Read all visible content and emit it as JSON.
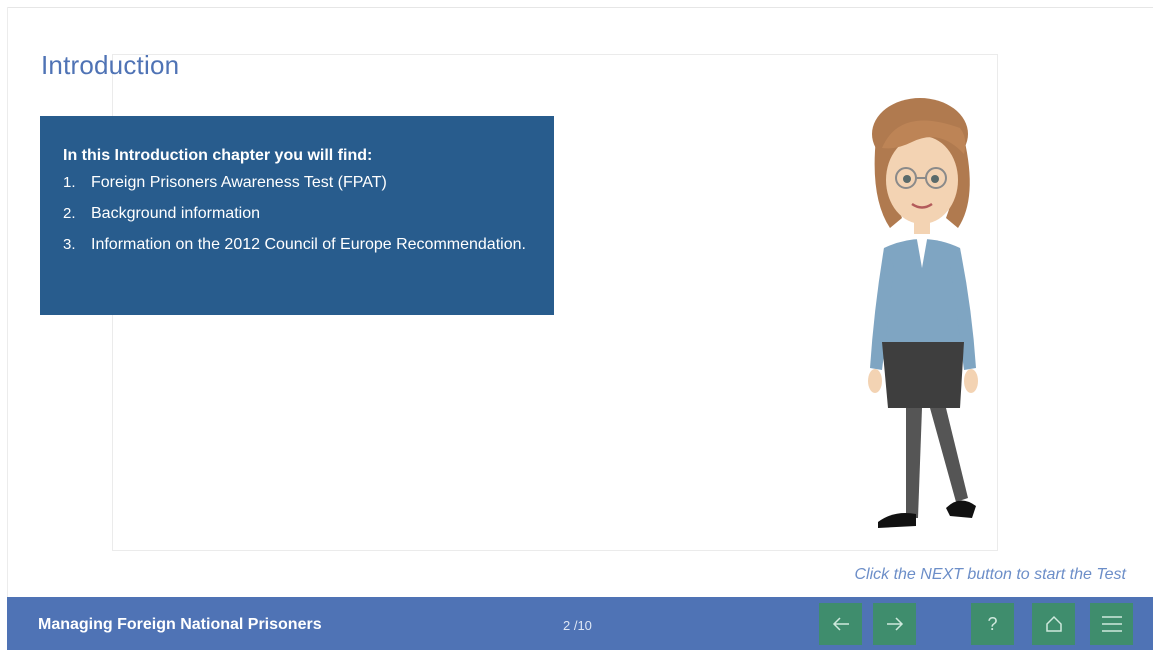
{
  "slide": {
    "title": "Introduction",
    "info": {
      "heading": "In this Introduction chapter you will find:",
      "items": [
        {
          "num": "1.",
          "text": "Foreign Prisoners Awareness Test (FPAT)"
        },
        {
          "num": "2.",
          "text": "Background information"
        },
        {
          "num": "3.",
          "text": "Information on the 2012 Council of Europe Recommendation."
        }
      ]
    },
    "hint": "Click the NEXT button to start the Test"
  },
  "footer": {
    "course_title": "Managing Foreign National Prisoners",
    "page_counter": "2 /10",
    "buttons": [
      {
        "name": "back-button",
        "icon": "arrow-left-icon"
      },
      {
        "name": "next-button",
        "icon": "arrow-right-icon"
      },
      {
        "name": "help-button",
        "icon": "question-icon",
        "glyph": "?"
      },
      {
        "name": "home-button",
        "icon": "home-icon"
      },
      {
        "name": "menu-button",
        "icon": "hamburger-menu-icon"
      }
    ]
  },
  "colors": {
    "accent_blue": "#4f73b5",
    "info_box": "#285c8d",
    "nav_button": "#3f8d6d",
    "hint_text": "#6c8ec8"
  }
}
